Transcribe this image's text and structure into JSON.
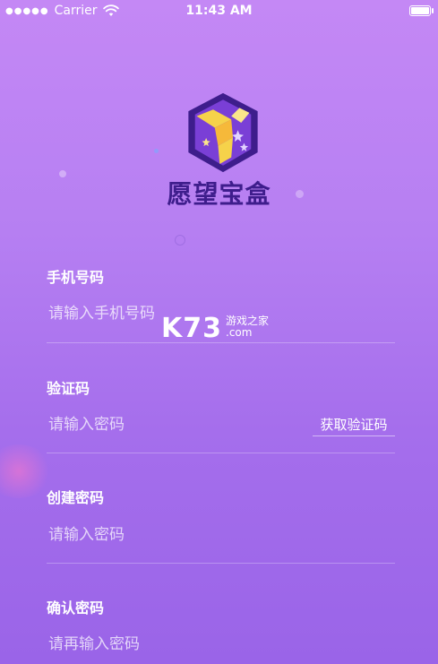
{
  "status_bar": {
    "carrier": "Carrier",
    "time": "11:43 AM",
    "battery_level": 1.0
  },
  "app": {
    "name": "愿望宝盒",
    "logo_icon": "gift-box-icon"
  },
  "watermark": {
    "brand": "K73",
    "sub_text": "游戏之家",
    "domain": ".com"
  },
  "form": {
    "phone": {
      "label": "手机号码",
      "placeholder": "请输入手机号码"
    },
    "code": {
      "label": "验证码",
      "placeholder": "请输入密码",
      "get_code_button": "获取验证码"
    },
    "password": {
      "label": "创建密码",
      "placeholder": "请输入密码"
    },
    "confirm": {
      "label": "确认密码",
      "placeholder": "请再输入密码"
    }
  },
  "colors": {
    "background_top": "#c488f5",
    "background_bottom": "#9a64e8",
    "logo_dark": "#3e1d8c",
    "logo_light": "#7a3fd6",
    "accent_yellow": "#f6d24a"
  }
}
